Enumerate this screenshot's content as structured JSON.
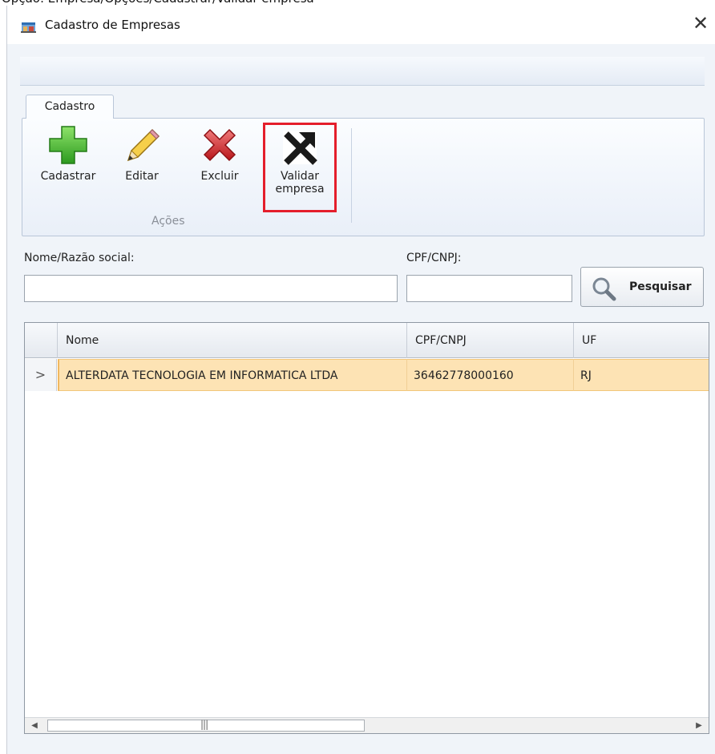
{
  "window": {
    "title": "Cadastro de Empresas",
    "close_glyph": "✕"
  },
  "ribbon": {
    "tab_label": "Cadastro",
    "buttons": {
      "add": "Cadastrar",
      "edit": "Editar",
      "delete": "Excluir",
      "validate_line1": "Validar",
      "validate_line2": "empresa"
    },
    "group_label": "Ações",
    "icons": {
      "add": "plus-icon",
      "edit": "pencil-icon",
      "delete": "x-icon",
      "validate": "arrow-cross-icon"
    },
    "highlight_color": "#e41e2b"
  },
  "filters": {
    "name_label": "Nome/Razão social:",
    "name_value": "",
    "doc_label": "CPF/CNPJ:",
    "doc_value": "",
    "search_label": "Pesquisar"
  },
  "grid": {
    "columns": [
      "Nome",
      "CPF/CNPJ",
      "UF"
    ],
    "rows": [
      {
        "indicator": ">",
        "nome": "ALTERDATA TECNOLOGIA EM INFORMATICA LTDA",
        "cpf_cnpj": "36462778000160",
        "uf": "RJ"
      }
    ],
    "selected_row_color": "#fde3b4",
    "scroll_thumb_grip": "|||"
  }
}
